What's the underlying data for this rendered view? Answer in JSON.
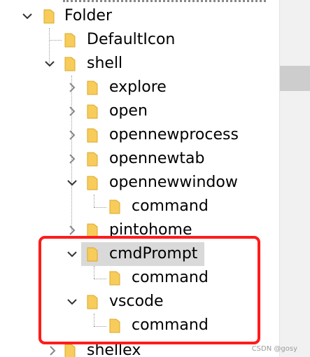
{
  "tree": {
    "items": [
      {
        "label": "Folder",
        "expanded": true
      },
      {
        "label": "DefaultIcon"
      },
      {
        "label": "shell",
        "expanded": true
      },
      {
        "label": "explore",
        "expanded": false
      },
      {
        "label": "open",
        "expanded": false
      },
      {
        "label": "opennewprocess",
        "expanded": false
      },
      {
        "label": "opennewtab",
        "expanded": false
      },
      {
        "label": "opennewwindow",
        "expanded": true
      },
      {
        "label": "command"
      },
      {
        "label": "pintohome",
        "expanded": false
      },
      {
        "label": "cmdPrompt",
        "expanded": true,
        "selected": true
      },
      {
        "label": "command"
      },
      {
        "label": "vscode",
        "expanded": true
      },
      {
        "label": "command"
      },
      {
        "label": "shellex",
        "expanded": false
      }
    ]
  },
  "watermark": "CSDN @gosy",
  "colors": {
    "folder_fill": "#f7cc5b",
    "folder_edge": "#dba728",
    "highlight_border": "#ff1b1b",
    "selection": "#d9d9d9"
  }
}
